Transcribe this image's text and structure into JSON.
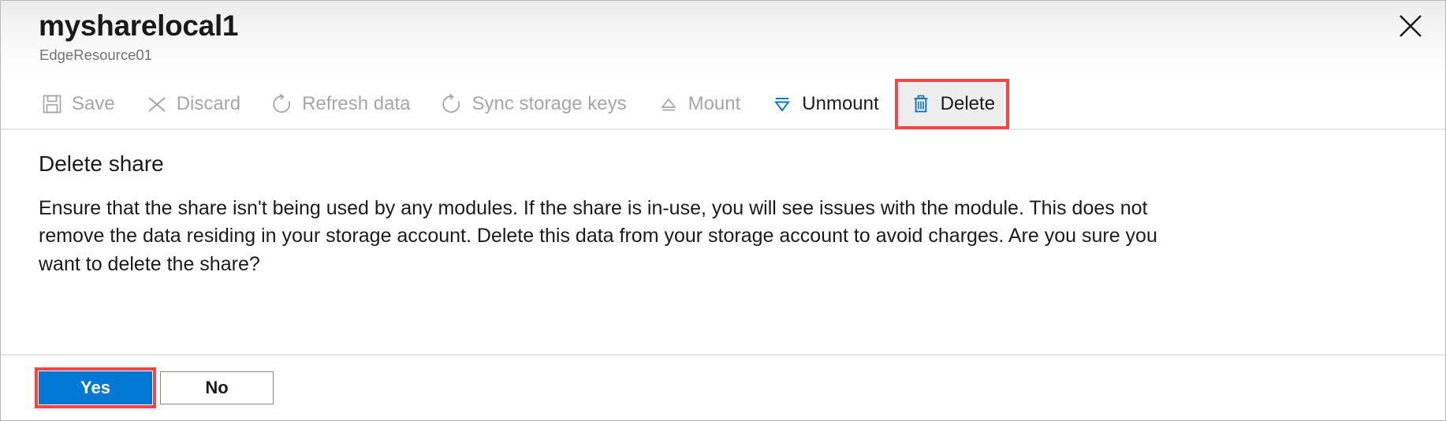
{
  "window": {
    "title": "mysharelocal1",
    "subtitle": "EdgeResource01",
    "close_icon": "close-icon"
  },
  "toolbar": {
    "commands": [
      {
        "id": "save",
        "label": "Save",
        "icon": "save-icon",
        "enabled": false,
        "highlighted": false
      },
      {
        "id": "discard",
        "label": "Discard",
        "icon": "cancel-x-icon",
        "enabled": false,
        "highlighted": false
      },
      {
        "id": "refresh",
        "label": "Refresh data",
        "icon": "refresh-icon",
        "enabled": false,
        "highlighted": false
      },
      {
        "id": "sync-keys",
        "label": "Sync storage keys",
        "icon": "sync-icon",
        "enabled": false,
        "highlighted": false
      },
      {
        "id": "mount",
        "label": "Mount",
        "icon": "mount-eject-icon",
        "enabled": false,
        "highlighted": false
      },
      {
        "id": "unmount",
        "label": "Unmount",
        "icon": "unmount-icon",
        "enabled": true,
        "highlighted": false
      },
      {
        "id": "delete",
        "label": "Delete",
        "icon": "trash-icon",
        "enabled": true,
        "highlighted": true
      }
    ]
  },
  "main": {
    "heading": "Delete share",
    "body": "Ensure that the share isn't being used by any modules. If the share is in-use, you will see issues with the module. This does not remove the data residing in your storage account. Delete this data from your storage account to avoid charges. Are you sure you want to delete the share?"
  },
  "footer": {
    "confirm_label": "Yes",
    "cancel_label": "No"
  },
  "colors": {
    "accent_blue": "#0078d4",
    "annotation_red": "#fb4343",
    "disabled_gray": "#a6a6a6",
    "hover_gray": "#ededed",
    "text": "#1b1b1b",
    "subtitle": "#737373"
  }
}
